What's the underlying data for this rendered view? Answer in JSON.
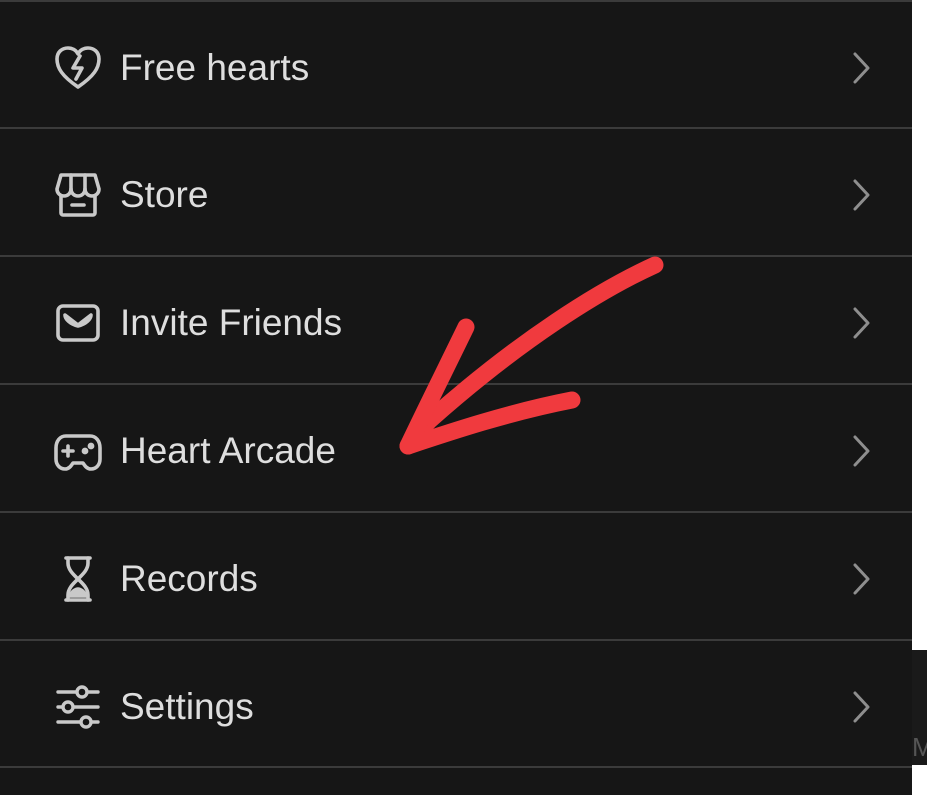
{
  "menu": {
    "items": [
      {
        "label": "Free hearts",
        "icon": "heart-bolt-icon"
      },
      {
        "label": "Store",
        "icon": "store-icon"
      },
      {
        "label": "Invite Friends",
        "icon": "envelope-icon"
      },
      {
        "label": "Heart Arcade",
        "icon": "gamepad-icon"
      },
      {
        "label": "Records",
        "icon": "hourglass-icon"
      },
      {
        "label": "Settings",
        "icon": "sliders-icon"
      }
    ]
  },
  "side_panel": {
    "clipped_text": "M"
  },
  "colors": {
    "background": "#161616",
    "divider": "#3b3b3b",
    "text": "#dedede",
    "icon": "#c9c9c9",
    "chevron": "#8e8e8e",
    "annotation_arrow": "#f03a3e"
  }
}
